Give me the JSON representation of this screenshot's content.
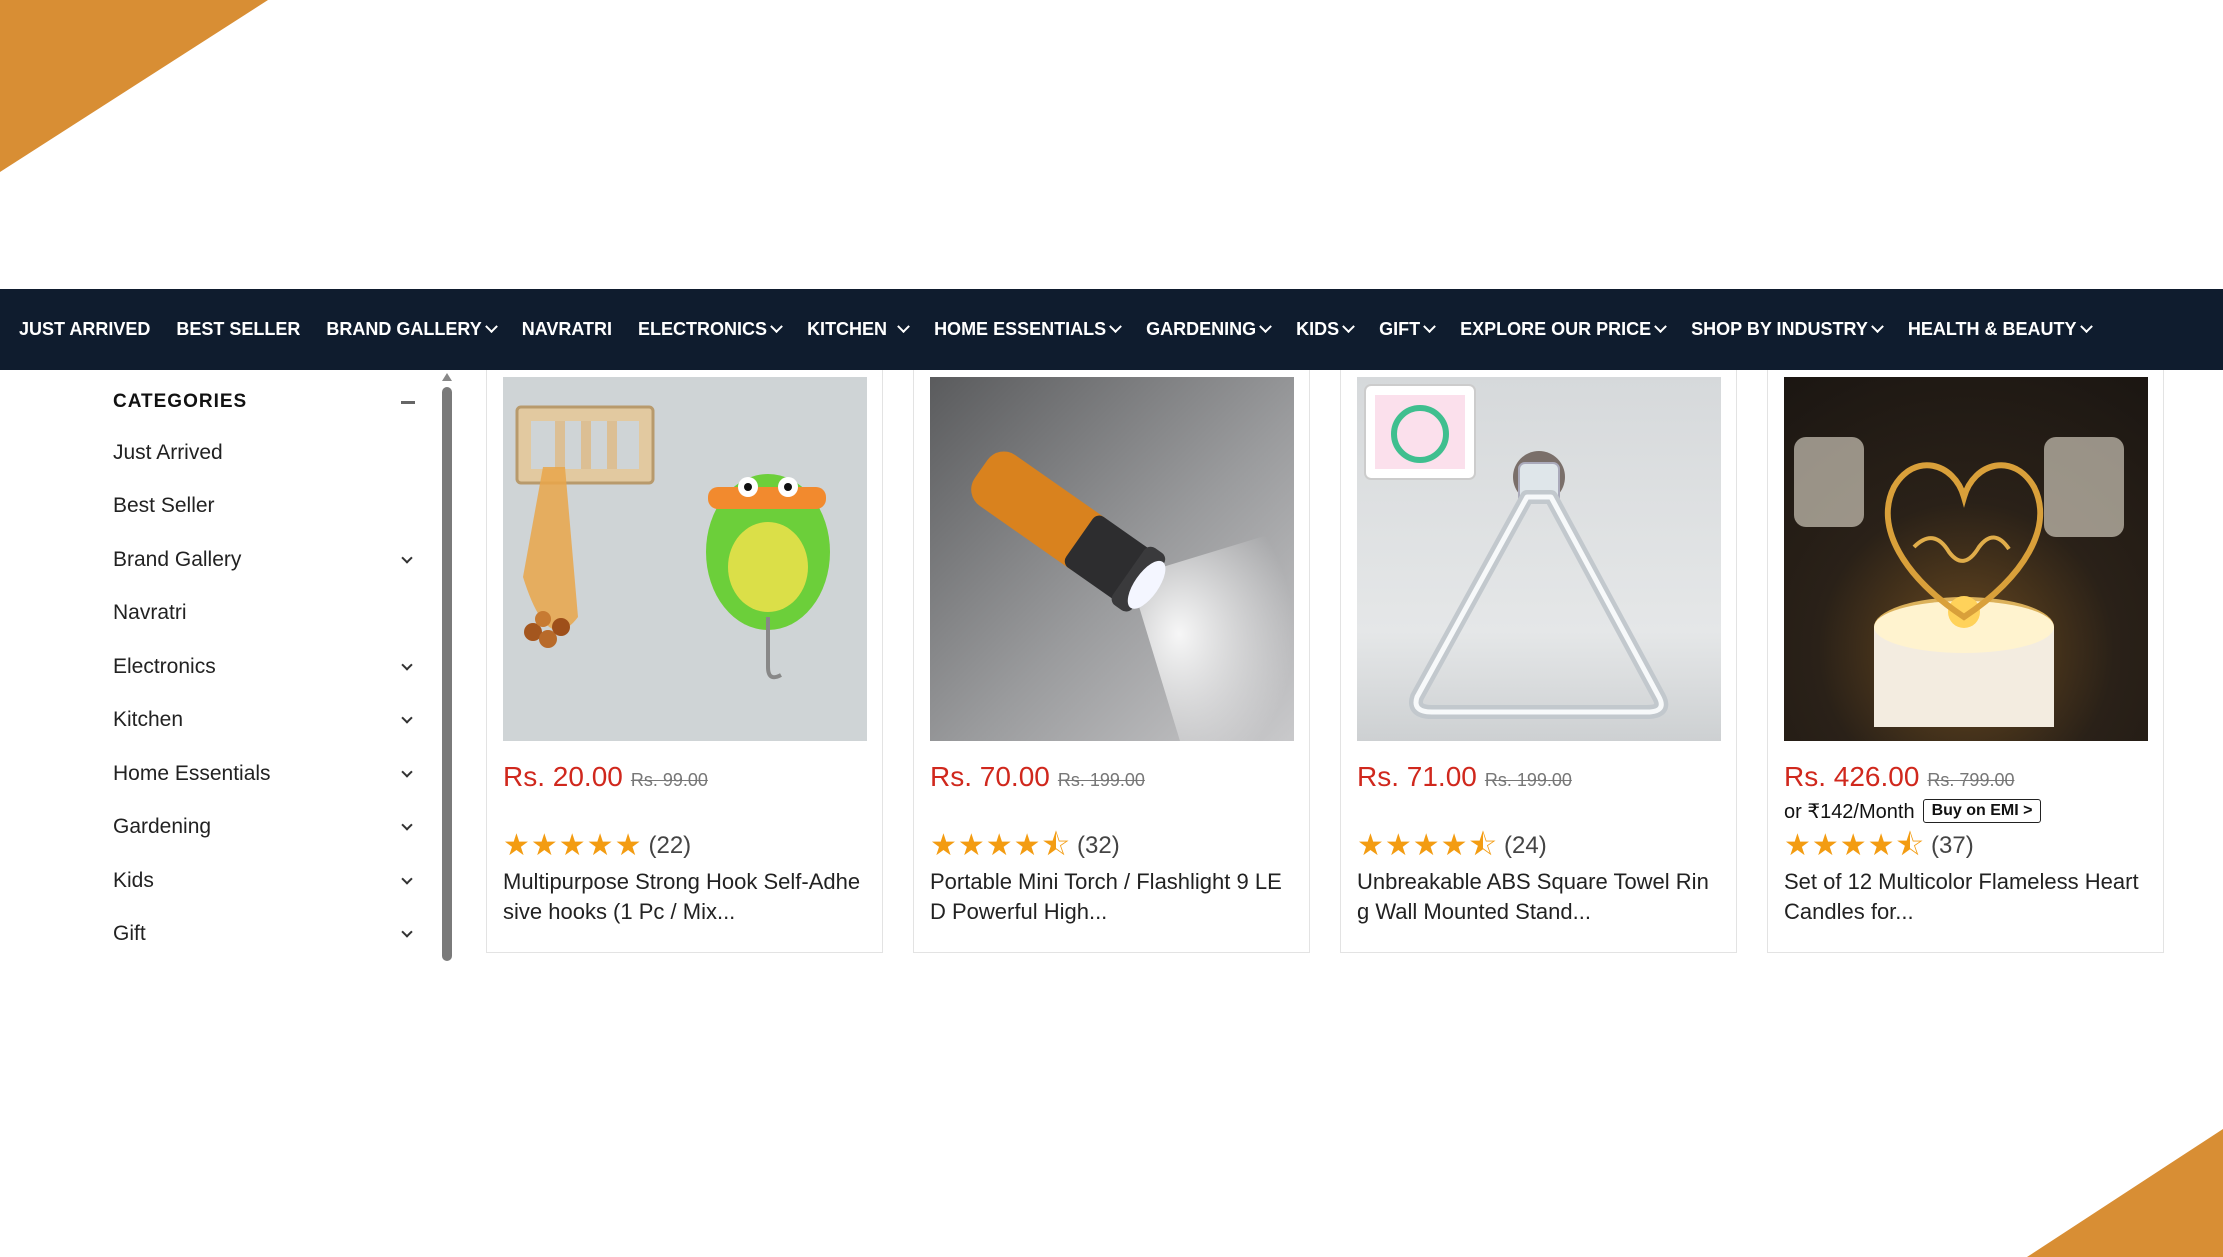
{
  "colors": {
    "accent": "#d88e34",
    "nav_bg": "#0f1c2e",
    "price": "#d0281d",
    "star": "#f39c12"
  },
  "nav": {
    "items": [
      {
        "label": "JUST ARRIVED",
        "has_dropdown": false
      },
      {
        "label": "BEST SELLER",
        "has_dropdown": false
      },
      {
        "label": "BRAND GALLERY",
        "has_dropdown": true
      },
      {
        "label": "NAVRATRI",
        "has_dropdown": false
      },
      {
        "label": "ELECTRONICS",
        "has_dropdown": true
      },
      {
        "label": "KITCHEN",
        "has_dropdown": true
      },
      {
        "label": "HOME ESSENTIALS",
        "has_dropdown": true
      },
      {
        "label": "GARDENING",
        "has_dropdown": true
      },
      {
        "label": "KIDS",
        "has_dropdown": true
      },
      {
        "label": "GIFT",
        "has_dropdown": true
      },
      {
        "label": "EXPLORE OUR PRICE",
        "has_dropdown": true
      },
      {
        "label": "SHOP BY INDUSTRY",
        "has_dropdown": true
      },
      {
        "label": "HEALTH & BEAUTY",
        "has_dropdown": true
      }
    ]
  },
  "sidebar": {
    "title": "CATEGORIES",
    "items": [
      {
        "label": "Just Arrived",
        "has_dropdown": false
      },
      {
        "label": "Best Seller",
        "has_dropdown": false
      },
      {
        "label": "Brand Gallery",
        "has_dropdown": true
      },
      {
        "label": "Navratri",
        "has_dropdown": false
      },
      {
        "label": "Electronics",
        "has_dropdown": true
      },
      {
        "label": "Kitchen",
        "has_dropdown": true
      },
      {
        "label": "Home Essentials",
        "has_dropdown": true
      },
      {
        "label": "Gardening",
        "has_dropdown": true
      },
      {
        "label": "Kids",
        "has_dropdown": true
      },
      {
        "label": "Gift",
        "has_dropdown": true
      }
    ]
  },
  "products": [
    {
      "image": "wall-hooks",
      "price": "Rs. 20.00",
      "old_price": "Rs. 99.00",
      "emi": null,
      "emi_button": null,
      "rating": 5,
      "stars": "★★★★★",
      "rating_count": "(22)",
      "title": "Multipurpose Strong Hook Self-Adhesive hooks (1 Pc / Mix..."
    },
    {
      "image": "torch",
      "price": "Rs. 70.00",
      "old_price": "Rs. 199.00",
      "emi": null,
      "emi_button": null,
      "rating": 4.5,
      "stars": "★★★★⯪",
      "rating_count": "(32)",
      "title": "Portable Mini Torch / Flashlight 9 LED Powerful High..."
    },
    {
      "image": "towel-ring",
      "price": "Rs. 71.00",
      "old_price": "Rs. 199.00",
      "emi": null,
      "emi_button": null,
      "rating": 4.5,
      "stars": "★★★★⯪",
      "rating_count": "(24)",
      "title": "Unbreakable ABS Square Towel Ring Wall Mounted Stand..."
    },
    {
      "image": "heart-candles",
      "price": "Rs. 426.00",
      "old_price": "Rs. 799.00",
      "emi": "or ₹142/Month",
      "emi_button": "Buy on EMI >",
      "rating": 4.5,
      "stars": "★★★★⯪",
      "rating_count": "(37)",
      "title": "Set of 12 Multicolor Flameless Heart Candles for..."
    }
  ]
}
